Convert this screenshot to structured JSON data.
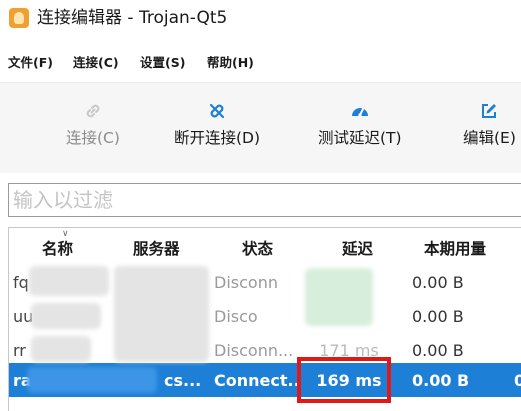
{
  "window": {
    "title": "连接编辑器 - Trojan-Qt5"
  },
  "menu": [
    {
      "label": "文件(F)"
    },
    {
      "label": "连接(C)"
    },
    {
      "label": "设置(S)"
    },
    {
      "label": "帮助(H)"
    }
  ],
  "toolbar": [
    {
      "label": "连接(C)",
      "icon": "link-icon",
      "enabled": false
    },
    {
      "label": "断开连接(D)",
      "icon": "unlink-icon",
      "enabled": true
    },
    {
      "label": "测试延迟(T)",
      "icon": "speedometer-icon",
      "enabled": true
    },
    {
      "label": "编辑(E)",
      "icon": "edit-icon",
      "enabled": true
    }
  ],
  "filter": {
    "placeholder": "输入以过滤",
    "value": ""
  },
  "table": {
    "columns": [
      "名称",
      "服务器",
      "状态",
      "延迟",
      "本期用量"
    ],
    "rows": [
      {
        "name": "fq",
        "server": "",
        "status": "Disconn",
        "latency": "",
        "usage": "0.00  B",
        "extra": ""
      },
      {
        "name": "uu",
        "server": "",
        "status": "Disco",
        "latency": "",
        "usage": "0.00  B",
        "extra": ""
      },
      {
        "name": "rr",
        "server": "",
        "status": "Disconn...",
        "latency": "171 ms",
        "usage": "0.00  B",
        "extra": ""
      },
      {
        "name": "ra",
        "server": "cs...",
        "status": "Connect...",
        "latency": "169 ms",
        "usage": "0.00  B",
        "extra": "0",
        "selected": true
      }
    ]
  },
  "colors": {
    "selection": "#1e7fd7",
    "highlight": "#e01818",
    "toolbar_icon": "#1e7fd7"
  }
}
